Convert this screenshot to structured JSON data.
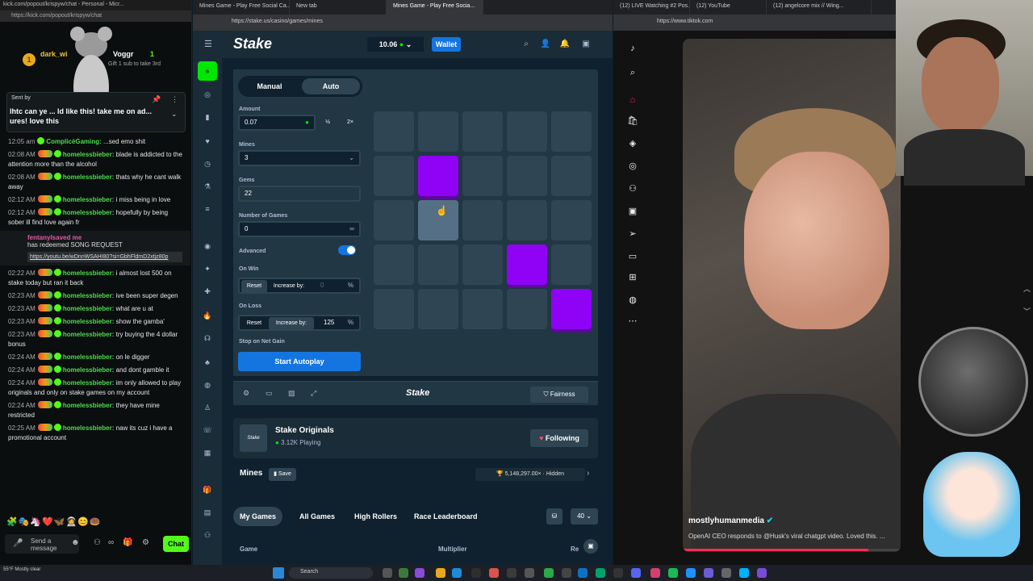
{
  "chat": {
    "title": "kick.com/popout/krispyw/chat - Personal - Micr...",
    "url": "https://kick.com/popout/krispyw/chat",
    "pinned_gift": {
      "user_left": "dark_wi",
      "user_right": "Voggr",
      "count": "1",
      "sub_text": "Gift 1 sub to take 3rd",
      "coin": "1"
    },
    "pinned_by": "Sent by",
    "pinned_message": "lhtc can ye ... ld like this! take me on ad... ures! love this",
    "messages": [
      {
        "time": "12:05 am",
        "user": "ComplicèGaming:",
        "text": "...sed emo shit"
      },
      {
        "time": "02:08 AM",
        "user": "homelessbieber:",
        "text": "blade is addicted to the attention more than the alcohol"
      },
      {
        "time": "02:08 AM",
        "user": "homelessbieber:",
        "text": "thats why he cant walk away"
      },
      {
        "time": "02:12 AM",
        "user": "homelessbieber:",
        "text": "i miss being in love"
      },
      {
        "time": "02:12 AM",
        "user": "homelessbieber:",
        "text": "hopefully by being sober ill find love again fr"
      }
    ],
    "redeem": {
      "user": "fentanylsaved me",
      "text": "has redeemed SONG REQUEST",
      "link": "https://youtu.be/wDnnWSAHI80?si=GbhFldmD2xtjz80p"
    },
    "messages2": [
      {
        "time": "02:22 AM",
        "user": "homelessbieber:",
        "text": "i almost lost 500 on stake today but ran it back"
      },
      {
        "time": "02:23 AM",
        "user": "homelessbieber:",
        "text": "ive been super degen"
      },
      {
        "time": "02:23 AM",
        "user": "homelessbieber:",
        "text": "what are u at"
      },
      {
        "time": "02:23 AM",
        "user": "homelessbieber:",
        "text": "show the gamba'"
      },
      {
        "time": "02:23 AM",
        "user": "homelessbieber:",
        "text": "try buying the 4 dollar bonus"
      },
      {
        "time": "02:24 AM",
        "user": "homelessbieber:",
        "text": "on le digger"
      },
      {
        "time": "02:24 AM",
        "user": "homelessbieber:",
        "text": "and dont gamble it"
      },
      {
        "time": "02:24 AM",
        "user": "homelessbieber:",
        "text": "im only allowed to play originals and only on stake games on my account"
      },
      {
        "time": "02:24 AM",
        "user": "homelessbieber:",
        "text": "they have mine restricted"
      },
      {
        "time": "02:25 AM",
        "user": "homelessbieber:",
        "text": "naw its cuz i have a promotional account"
      }
    ],
    "emotes": "🧩🎭🦄❤️🦋🧑‍🚀😊🍩",
    "send_placeholder": "Send a message",
    "chat_button": "Chat"
  },
  "stake": {
    "tabs": [
      "Mines Game - Play Free Social Ca...",
      "New tab",
      "Mines Game - Play Free Socia..."
    ],
    "url": "https://stake.us/casino/games/mines",
    "logo": "Stake",
    "balance": "10.06",
    "wallet": "Wallet",
    "mode_tabs": {
      "manual": "Manual",
      "auto": "Auto"
    },
    "amount_label": "Amount",
    "amount_value": "0.07",
    "half": "½",
    "double": "2×",
    "mines_label": "Mines",
    "mines_value": "3",
    "gems_label": "Gems",
    "gems_value": "22",
    "games_label": "Number of Games",
    "games_value": "0",
    "advanced_label": "Advanced",
    "on_win_label": "On Win",
    "on_loss_label": "On Loss",
    "reset": "Reset",
    "increase_by": "Increase by:",
    "win_value": "0",
    "loss_value": "125",
    "percent": "%",
    "stop_label": "Stop on Net Gain",
    "start_button": "Start Autoplay",
    "grid": [
      [
        "empty",
        "empty",
        "empty",
        "empty",
        "empty"
      ],
      [
        "empty",
        "gem",
        "empty",
        "empty",
        "empty"
      ],
      [
        "empty",
        "hover",
        "empty",
        "empty",
        "empty"
      ],
      [
        "empty",
        "empty",
        "empty",
        "gem",
        "empty"
      ],
      [
        "empty",
        "empty",
        "empty",
        "empty",
        "gem"
      ]
    ],
    "footer_logo": "Stake",
    "fairness": "Fairness",
    "originals_title": "Stake Originals",
    "originals_playing": "3.12K Playing",
    "originals_logo": "Stake",
    "following": "Following",
    "game_name": "Mines",
    "save": "Save",
    "hidden_stat": "5,148,297.00× · Hidden",
    "lb_tabs": [
      "My Games",
      "All Games",
      "High Rollers",
      "Race Leaderboard"
    ],
    "lb_count": "40",
    "table_headers": [
      "Game",
      "Multiplier",
      "Re"
    ]
  },
  "tiktok": {
    "tabs": [
      "(12) LIVE Watching #2 Pos...",
      "(12) YouTube",
      "(12) angelcore mix // Wing..."
    ],
    "url": "https://www.tiktok.com",
    "username": "mostlyhumanmedia",
    "caption": "OpenAI CEO responds to @Husk's viral chatgpt video. Loved this. ...",
    "progress": 0.85
  },
  "taskbar": {
    "weather": "55°F Mostly clear",
    "search": "Search"
  }
}
